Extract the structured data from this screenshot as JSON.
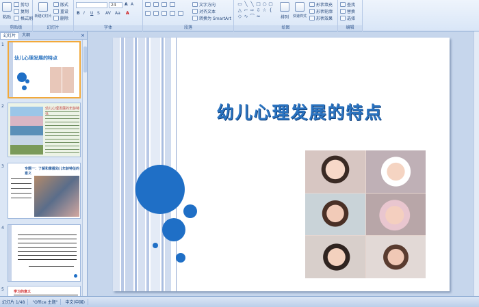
{
  "ribbon": {
    "clipboard": {
      "label": "剪贴板",
      "paste": "粘贴",
      "cut": "剪切",
      "copy": "复制",
      "format_painter": "格式刷"
    },
    "slides": {
      "label": "幻灯片",
      "new_slide": "新建幻灯片",
      "layout": "版式",
      "reset": "重设",
      "delete": "删除"
    },
    "font": {
      "label": "字体",
      "font_size": "24"
    },
    "paragraph": {
      "label": "段落",
      "text_direction": "文字方向",
      "align_text": "对齐文本",
      "smartart": "转换为 SmartArt"
    },
    "drawing": {
      "label": "绘图",
      "arrange": "排列",
      "quick_styles": "快速样式",
      "shape_fill": "形状填充",
      "shape_outline": "形状轮廓",
      "shape_effects": "形状效果"
    },
    "editing": {
      "label": "编辑",
      "find": "查找",
      "replace": "替换",
      "select": "选择"
    }
  },
  "panel": {
    "tab_slides": "幻灯片",
    "tab_outline": "大纲",
    "close": "×"
  },
  "thumbnails": [
    {
      "num": "1",
      "title": "幼儿心理发展的特点"
    },
    {
      "num": "2",
      "title": "幼儿心理发展的年龄特征"
    },
    {
      "num": "3",
      "title": "专题一：了解和掌握幼儿年龄特征的意义"
    },
    {
      "num": "4",
      "title": ""
    },
    {
      "num": "5",
      "title": "学习的意义"
    }
  ],
  "slide": {
    "title": "幼儿心理发展的特点"
  },
  "status": {
    "slide_info": "幻灯片 1/48",
    "theme": "\"Office 主题\"",
    "language": "中文(中国)"
  },
  "colors": {
    "accent": "#1f6fc6",
    "title": "#2a73c0",
    "stripe": "#b8c8e6"
  }
}
